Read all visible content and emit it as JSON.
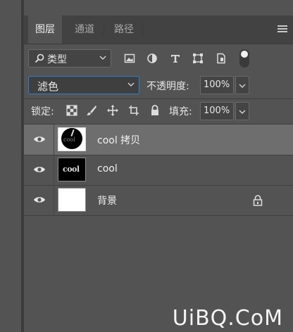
{
  "tabs": [
    {
      "label": "图层",
      "active": true
    },
    {
      "label": "通道",
      "active": false
    },
    {
      "label": "路径",
      "active": false
    }
  ],
  "filter": {
    "kind_label": "类型"
  },
  "blend": {
    "mode": "滤色",
    "opacity_label": "不透明度:",
    "opacity_value": "100%"
  },
  "lock": {
    "label": "锁定:",
    "fill_label": "填充:",
    "fill_value": "100%"
  },
  "layers": [
    {
      "name": "cool 拷贝",
      "selected": true,
      "thumb": "circle-mask"
    },
    {
      "name": "cool",
      "selected": false,
      "thumb": "text"
    },
    {
      "name": "背景",
      "selected": false,
      "thumb": "white",
      "locked": true
    }
  ],
  "thumb_text": "cool",
  "watermark": "UiBQ.CoM",
  "colors": {
    "accent_border": "#2d7fd3",
    "panel_bg": "#535353",
    "selected_row": "#6e6e6e"
  }
}
